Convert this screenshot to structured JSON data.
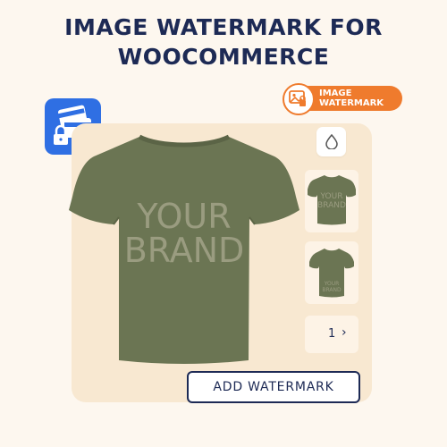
{
  "header": {
    "title_line1": "IMAGE WATERMARK FOR",
    "title_line2": "WOOCOMMERCE"
  },
  "badge": {
    "line1": "IMAGE",
    "line2": "WATERMARK"
  },
  "product": {
    "watermark_line1": "YOUR",
    "watermark_line2": "BRAND"
  },
  "thumbnails": [
    {
      "watermark_line1": "YOUR",
      "watermark_line2": "BRAND"
    },
    {
      "watermark_line1": "YOUR",
      "watermark_line2": "BRAND"
    }
  ],
  "pager": {
    "current_page": "1",
    "next_icon": "›"
  },
  "actions": {
    "add_watermark_label": "ADD WATERMARK"
  },
  "colors": {
    "accent": "#2f6fe3",
    "badge": "#ef7b2d",
    "navy": "#1d2a55",
    "shirt": "#6b7553",
    "card": "#f8e8d1"
  },
  "icons": [
    "card-lock-icon",
    "image-watermark-icon",
    "drop-icon",
    "chevron-right-icon"
  ]
}
